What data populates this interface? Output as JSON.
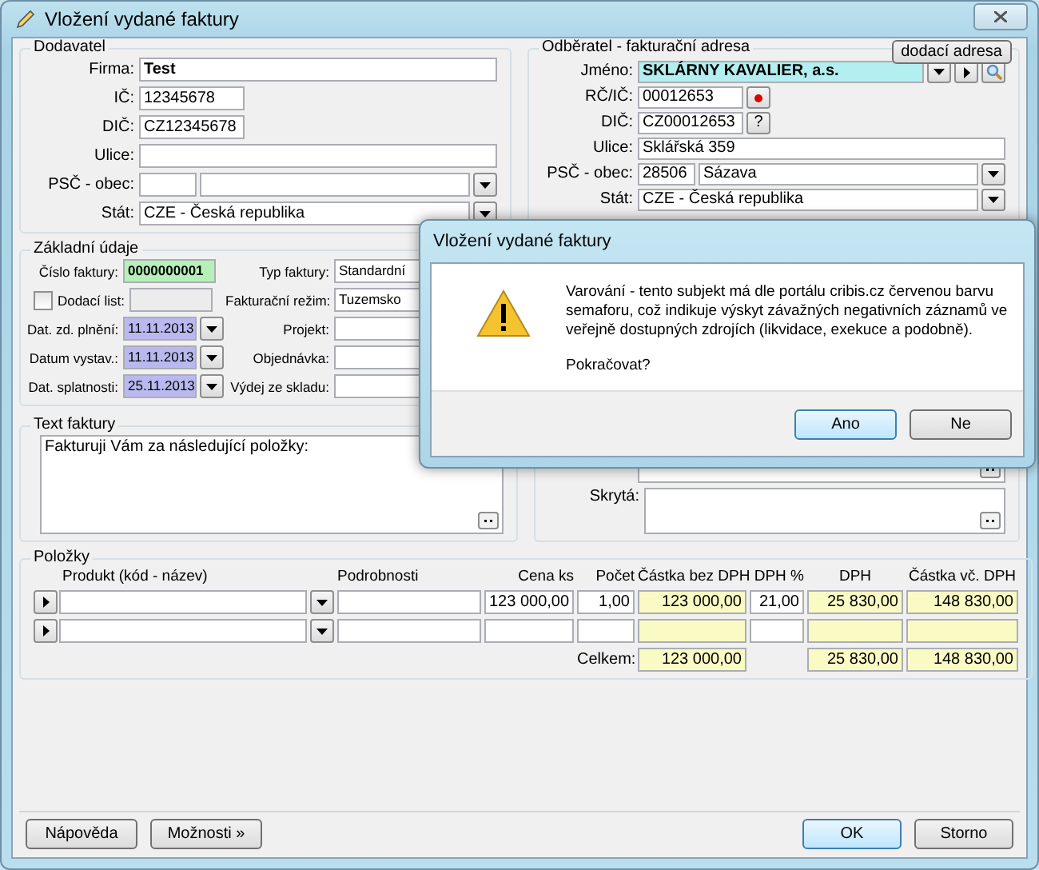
{
  "window": {
    "title": "Vložení vydané faktury"
  },
  "supplier": {
    "title": "Dodavatel",
    "fields": [
      {
        "kind": "name",
        "label": "Firma:",
        "value": "Test"
      },
      {
        "kind": "short",
        "label": "IČ:",
        "value": "12345678"
      },
      {
        "kind": "short",
        "label": "DIČ:",
        "value": "CZ12345678"
      },
      {
        "kind": "text",
        "label": "Ulice:"
      },
      {
        "kind": "psc",
        "label": "PSČ - obec:"
      },
      {
        "kind": "combo",
        "label": "Stát:",
        "value": "CZE - Česká republika"
      }
    ]
  },
  "customer": {
    "title": "Odběratel - fakturační adresa",
    "button": "dodací adresa",
    "fields": [
      {
        "kind": "name-combo",
        "label": "Jméno:",
        "value": "SKLÁRNY KAVALIER, a.s."
      },
      {
        "kind": "short-dot",
        "label": "RČ/IČ:",
        "value": "00012653"
      },
      {
        "kind": "short-help",
        "label": "DIČ:",
        "value": "CZ00012653",
        "button": "?"
      },
      {
        "kind": "text",
        "label": "Ulice:",
        "value": "Sklářská 359"
      },
      {
        "kind": "psc",
        "label": "PSČ - obec:",
        "value": "28506",
        "city": "Sázava"
      },
      {
        "kind": "combo",
        "label": "Stát:",
        "value": "CZE - Česká republika"
      }
    ]
  },
  "basic": {
    "title": "Základní údaje",
    "left": [
      {
        "kind": "number",
        "label": "Číslo faktury:",
        "value": "0000000001"
      },
      {
        "kind": "checkbox",
        "label": "Dodací list:",
        "checked": false
      },
      {
        "kind": "date",
        "label": "Dat. zd. plnění:",
        "value": "11.11.2013"
      },
      {
        "kind": "date",
        "label": "Datum vystav.:",
        "value": "11.11.2013"
      },
      {
        "kind": "date",
        "label": "Dat. splatnosti:",
        "value": "25.11.2013"
      }
    ],
    "right": [
      {
        "label": "Typ faktury:",
        "value": "Standardní"
      },
      {
        "label": "Fakturační režim:",
        "value": "Tuzemsko"
      },
      {
        "label": "Projekt:"
      },
      {
        "label": "Objednávka:"
      },
      {
        "label": "Výdej ze skladu:"
      }
    ]
  },
  "invoice_text": {
    "title": "Text faktury",
    "value": "Fakturuji Vám za následující položky:"
  },
  "hidden_note": {
    "label": "Skrytá:"
  },
  "items": {
    "title": "Položky",
    "columns": [
      "Produkt (kód - název)",
      "Podrobnosti",
      "Cena ks",
      "Počet",
      "Částka bez DPH",
      "DPH %",
      "DPH",
      "Částka vč. DPH"
    ],
    "rows": [
      {
        "price": "123 000,00",
        "count": "1,00",
        "net": "123 000,00",
        "vat_rate": "21,00",
        "vat": "25 830,00",
        "gross": "148 830,00"
      },
      {}
    ],
    "total": {
      "label": "Celkem:",
      "net": "123 000,00",
      "vat": "25 830,00",
      "gross": "148 830,00"
    }
  },
  "footer": {
    "left": [
      {
        "label": "Nápověda",
        "default": false
      },
      {
        "label": "Možnosti »",
        "default": false
      }
    ],
    "right": [
      {
        "label": "OK",
        "default": true
      },
      {
        "label": "Storno",
        "default": false
      }
    ]
  },
  "dialog": {
    "title": "Vložení vydané faktury",
    "message": "Varování - tento subjekt má dle portálu cribis.cz červenou barvu semaforu, což indikuje výskyt závažných negativních záznamů ve veřejně dostupných zdrojích (likvidace, exekuce a podobně).",
    "question": "Pokračovat?",
    "buttons": [
      {
        "label": "Ano",
        "default": true
      },
      {
        "label": "Ne",
        "default": false
      }
    ]
  }
}
